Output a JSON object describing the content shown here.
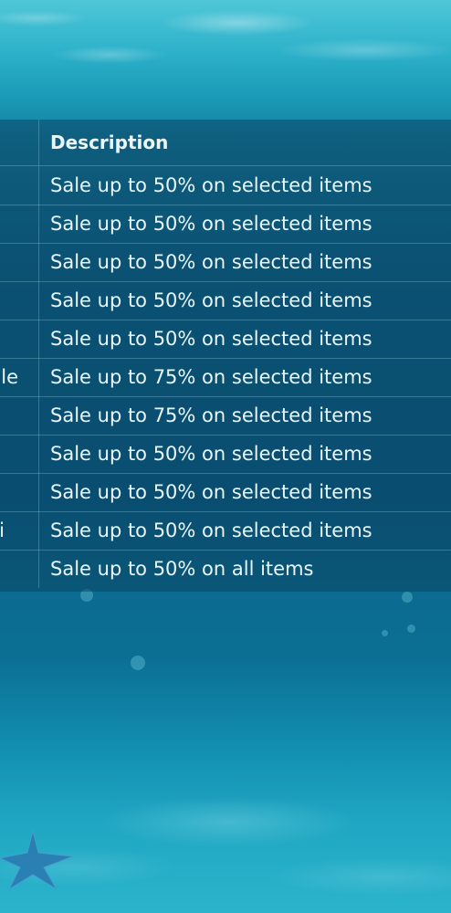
{
  "table": {
    "header": {
      "left_label": "",
      "description": "Description"
    },
    "rows": [
      {
        "left": "",
        "description": "Sale up to 50% on selected items"
      },
      {
        "left": "",
        "description": "Sale up to 50% on selected items"
      },
      {
        "left": "",
        "description": "Sale up to 50% on selected items"
      },
      {
        "left": "",
        "description": "Sale up to 50% on selected items"
      },
      {
        "left": "",
        "description": "Sale up to 50% on selected items"
      },
      {
        "left": "le",
        "description": "Sale up to 75% on selected items"
      },
      {
        "left": "",
        "description": "Sale up to 75% on selected items"
      },
      {
        "left": "",
        "description": "Sale up to 50% on selected items"
      },
      {
        "left": "",
        "description": "Sale up to 50% on selected items"
      },
      {
        "left": "i",
        "description": "Sale up to 50% on selected items"
      },
      {
        "left": "",
        "description": "Sale up to 50% on all items"
      }
    ]
  },
  "decor": {
    "starfish_icon": "starfish-icon",
    "background_theme": "underwater",
    "accent_color": "#0b5a80"
  }
}
